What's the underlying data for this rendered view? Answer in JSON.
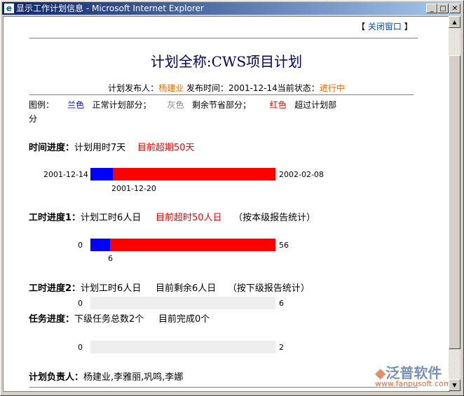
{
  "window": {
    "title": "显示工作计划信息 - Microsoft Internet Explorer",
    "close_link": "关闭窗口"
  },
  "plan": {
    "title": "计划全称:CWS项目计划",
    "publisher_label": "计划发布人：",
    "publisher": "杨建业",
    "time_label": "发布时间：",
    "time": "2001-12-14",
    "status_label": "当前状态：",
    "status": "进行中"
  },
  "legend": {
    "label": "图例：",
    "blue": "兰色",
    "blue_desc": "正常计划部分；",
    "gray": "灰色",
    "gray_desc": "剩余节省部分；",
    "red": "红色",
    "red_desc": "超过计划部分"
  },
  "time_progress": {
    "label": "时间进度：",
    "text": "计划用时7天",
    "over": "目前超期50天",
    "start": "2001-12-14",
    "end": "2002-02-08",
    "marker": "2001-12-20",
    "planned_fraction": 0.12
  },
  "hours1": {
    "label": "工时进度1：",
    "text": "计划工时6人日",
    "over": "目前超时50人日",
    "note": "（按本级报告统计）",
    "min": "0",
    "max": "56",
    "marker": "6",
    "planned_fraction": 0.107
  },
  "hours2": {
    "label": "工时进度2：",
    "text": "计划工时6人日",
    "remain": "目前剩余6人日",
    "note": "（按下级报告统计）",
    "min": "0",
    "max": "6"
  },
  "tasks": {
    "label": "任务进度：",
    "text": "下级任务总数2个",
    "done": "目前完成0个",
    "min": "0",
    "max": "2"
  },
  "owners": {
    "label": "计划负责人：",
    "names": "杨建业,李雅丽,巩鸣,李娜"
  },
  "watermark": {
    "brand": "泛普软件",
    "url": "www.fanpusoft.com"
  }
}
